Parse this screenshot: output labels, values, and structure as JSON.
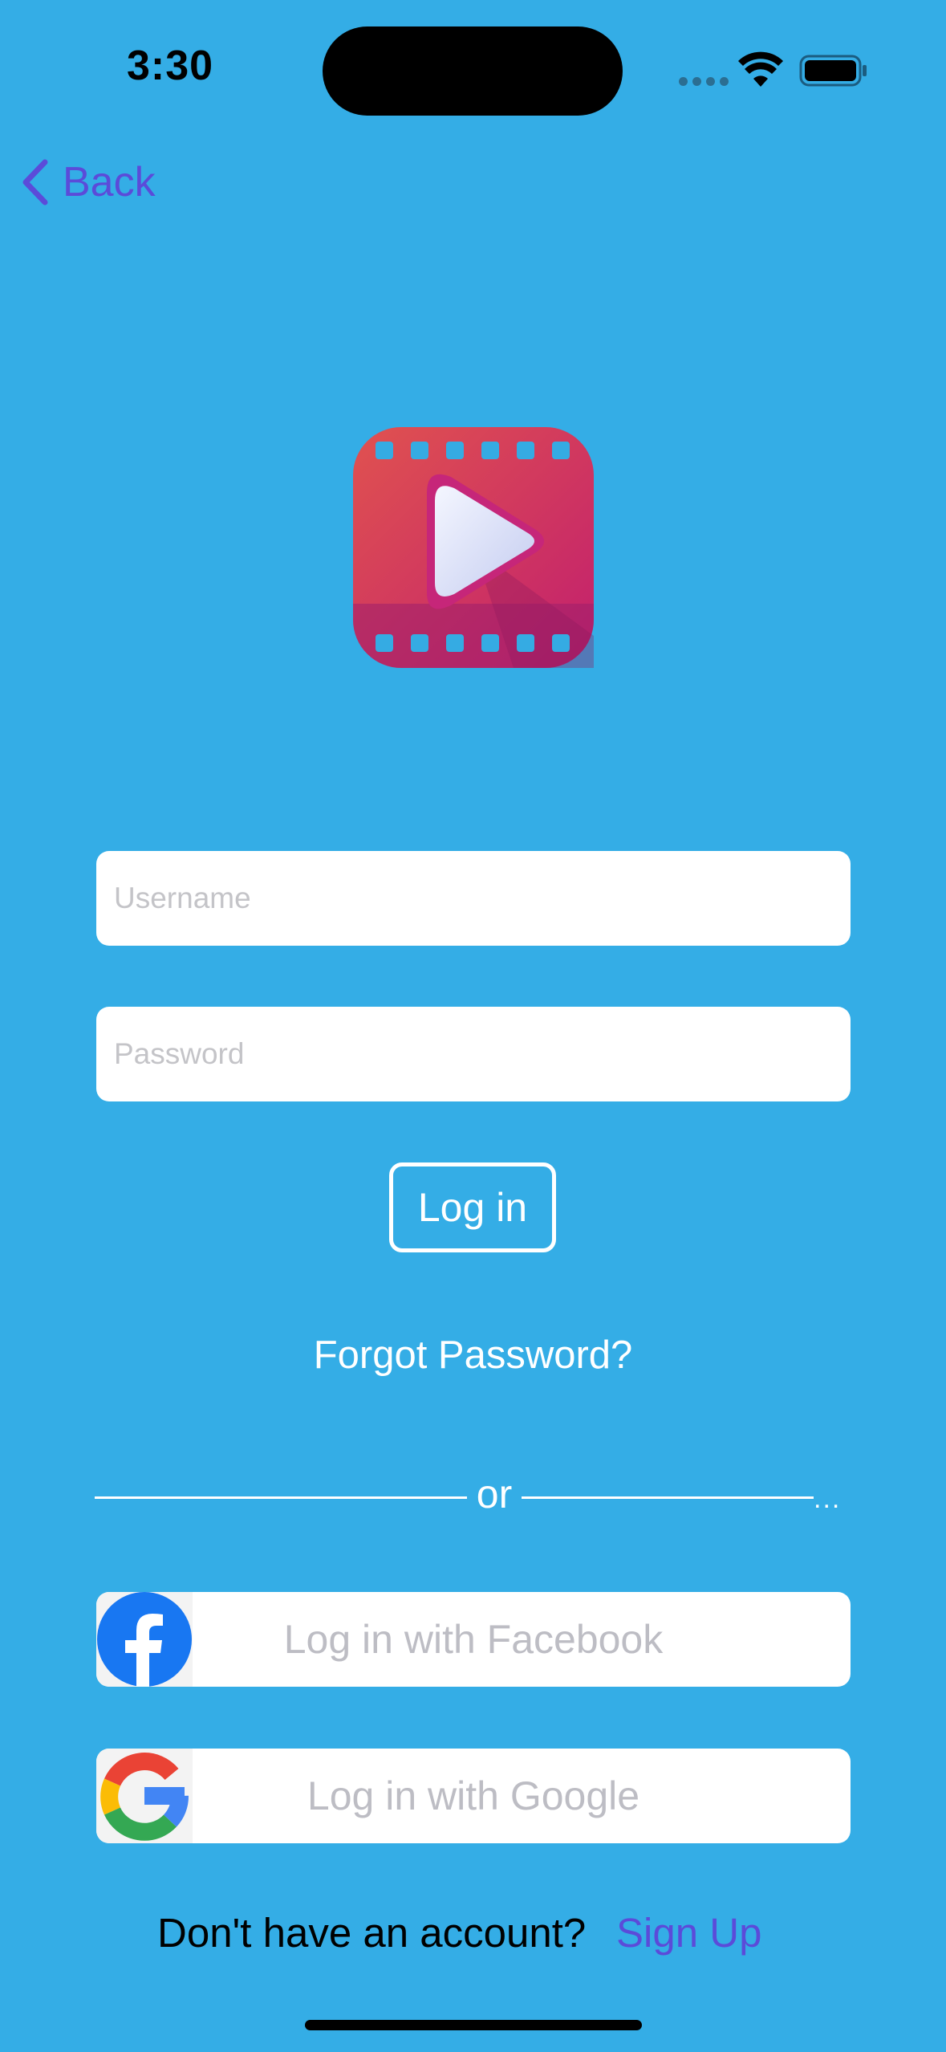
{
  "status_bar": {
    "time": "3:30"
  },
  "nav": {
    "back_label": "Back"
  },
  "app": {
    "logo_icon": "movie-play-icon",
    "accent_color": "#5B4BD9",
    "background_color": "#34ADE6"
  },
  "form": {
    "username_placeholder": "Username",
    "password_placeholder": "Password",
    "login_label": "Log in",
    "forgot_label": "Forgot Password?"
  },
  "divider": {
    "text": "or",
    "ellipsis": "..."
  },
  "social": {
    "facebook_label": "Log in with Facebook",
    "facebook_icon": "facebook-icon",
    "google_label": "Log in with Google",
    "google_icon": "google-icon"
  },
  "signup": {
    "prompt": "Don't have an account?",
    "link": "Sign Up"
  }
}
